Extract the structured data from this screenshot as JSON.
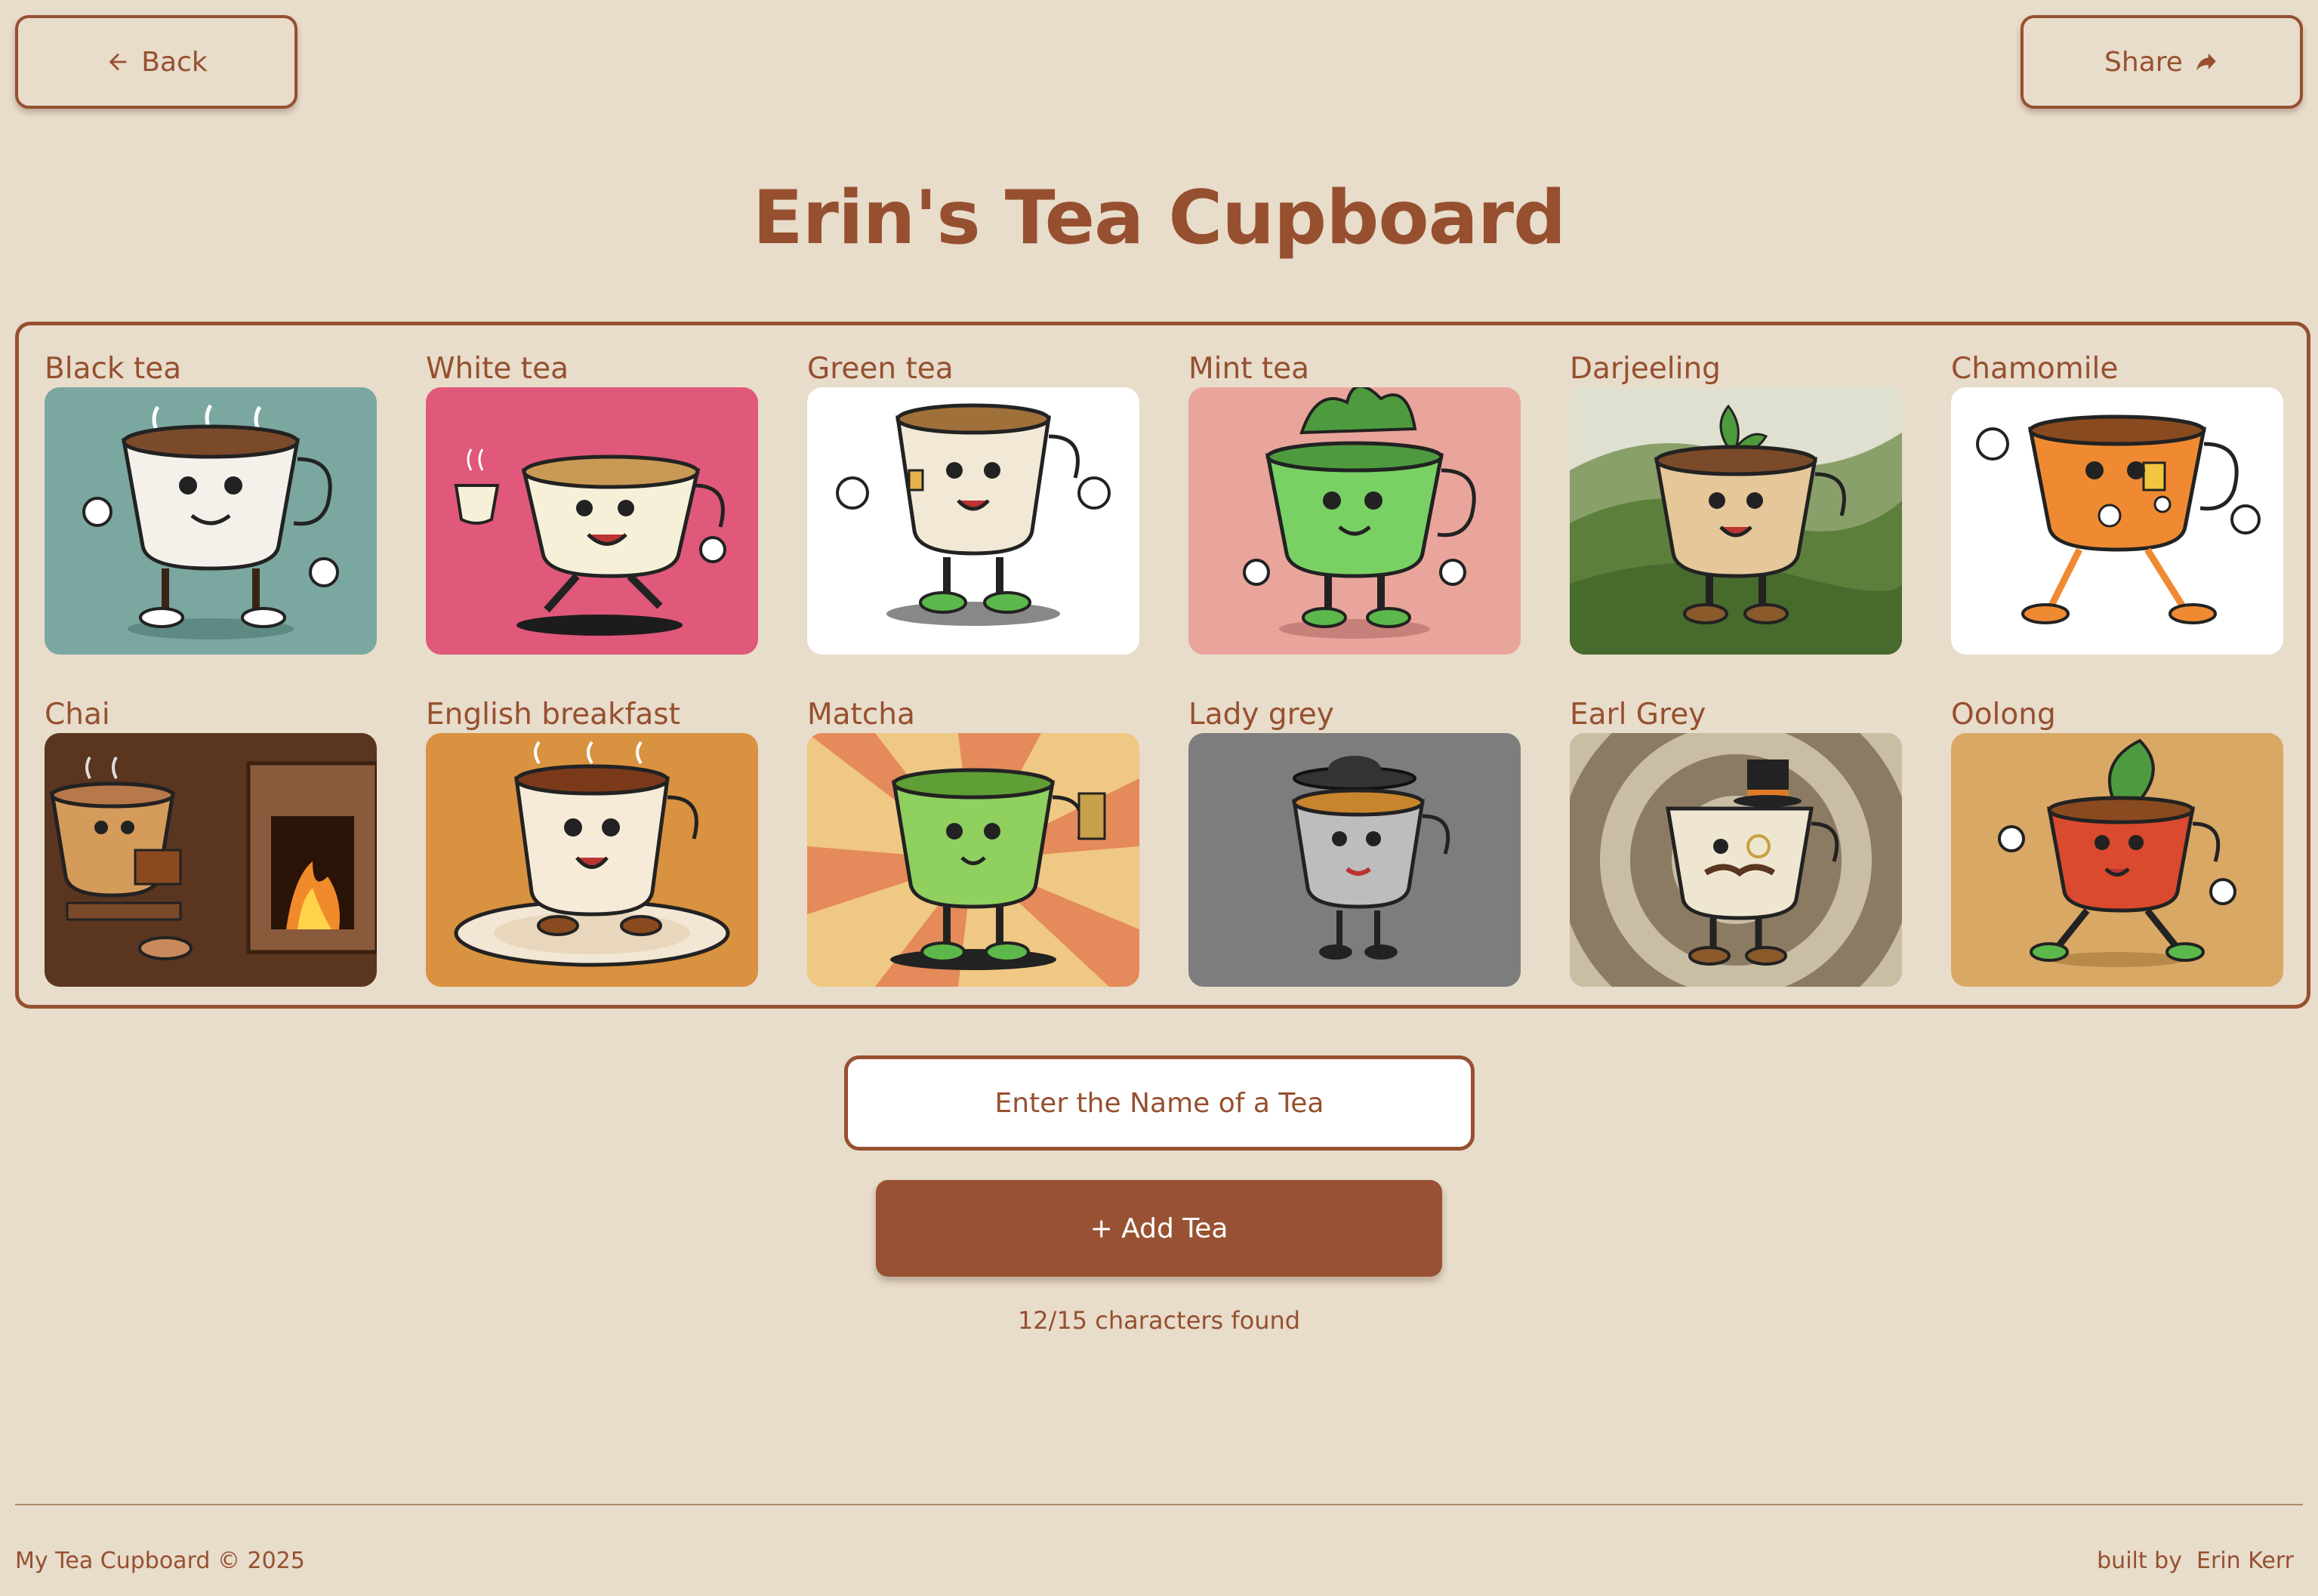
{
  "header": {
    "back_label": "Back",
    "share_label": "Share",
    "title": "Erin's Tea Cupboard"
  },
  "teas": [
    {
      "name": "Black tea",
      "bg": "#7aa7a0"
    },
    {
      "name": "White tea",
      "bg": "#e0587a"
    },
    {
      "name": "Green tea",
      "bg": "#ffffff"
    },
    {
      "name": "Mint tea",
      "bg": "#e9a59b"
    },
    {
      "name": "Darjeeling",
      "bg": "#6f8f55"
    },
    {
      "name": "Chamomile",
      "bg": "#ffffff"
    },
    {
      "name": "Chai",
      "bg": "#5a3520"
    },
    {
      "name": "English breakfast",
      "bg": "#d9923f"
    },
    {
      "name": "Matcha",
      "bg": "#efc883"
    },
    {
      "name": "Lady grey",
      "bg": "#7d7d7d"
    },
    {
      "name": "Earl Grey",
      "bg": "#8c7b63"
    },
    {
      "name": "Oolong",
      "bg": "#d9a865"
    }
  ],
  "form": {
    "input_placeholder": "Enter the Name of a Tea",
    "input_value": "",
    "add_button_label": "+ Add Tea",
    "progress_text": "12/15 characters found"
  },
  "footer": {
    "left": "My Tea Cupboard © 2025",
    "right": "built by  Erin Kerr"
  },
  "colors": {
    "page_bg": "#e8dccb",
    "accent": "#96502f",
    "button_bg": "#985233"
  }
}
